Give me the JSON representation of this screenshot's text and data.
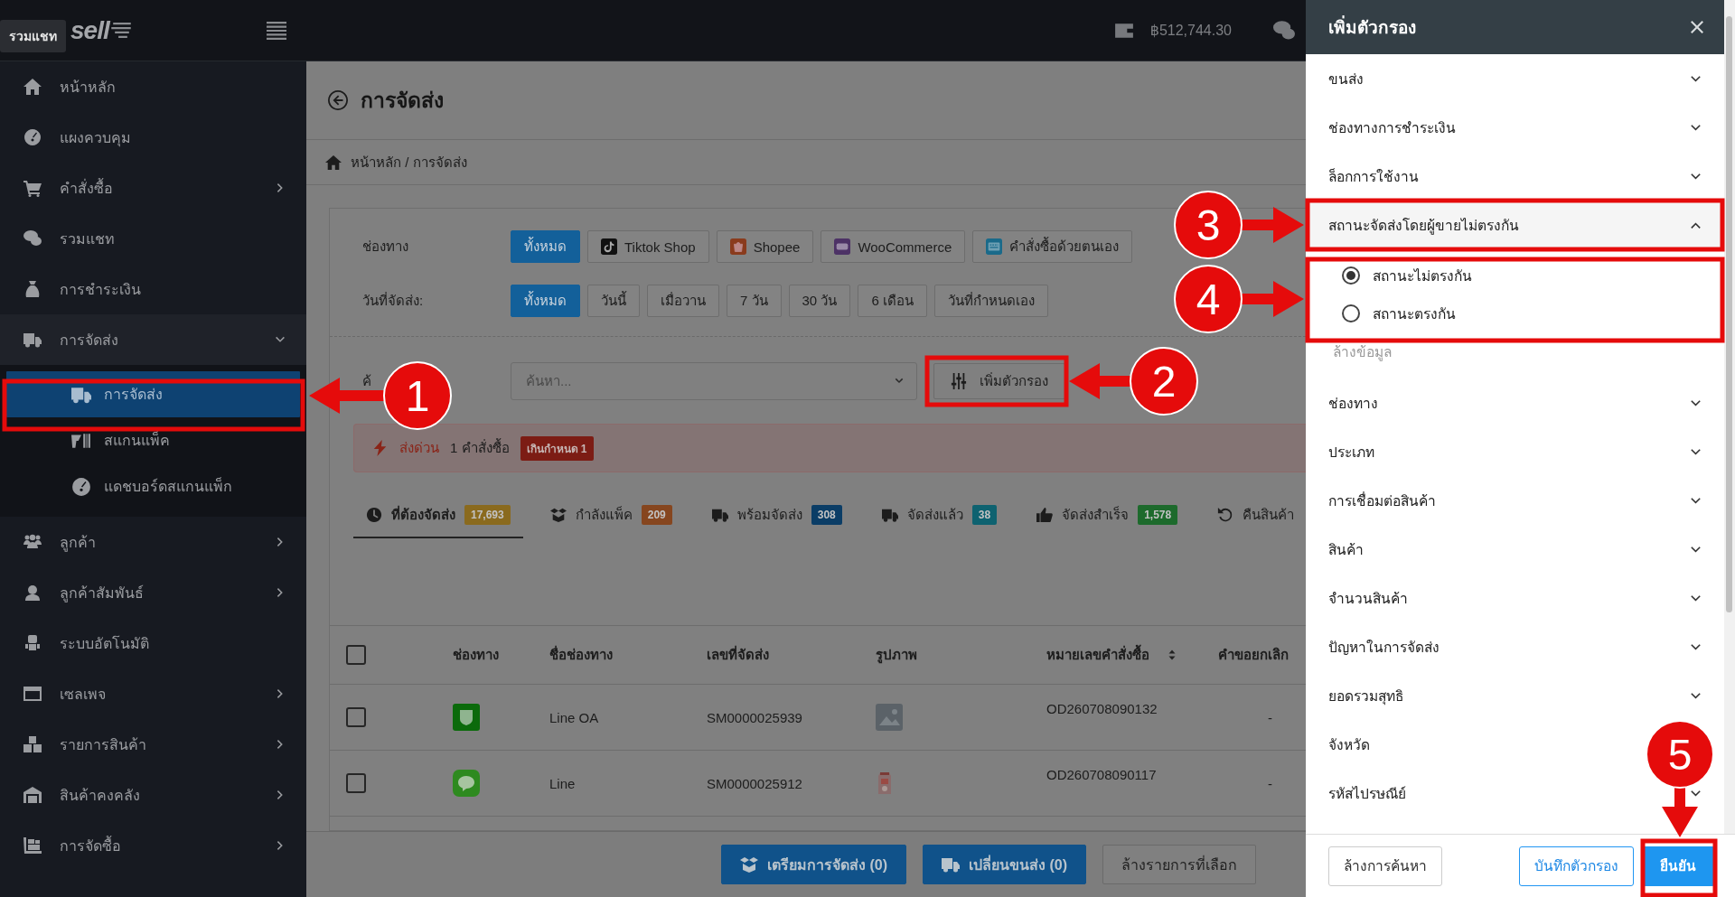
{
  "tooltip": {
    "text": "รวมแชท"
  },
  "logo": {
    "text": "sell"
  },
  "topbar": {
    "balance": "฿512,744.30"
  },
  "sidebar": {
    "items": [
      {
        "label": "หน้าหลัก",
        "has_submenu": false,
        "selected": false
      },
      {
        "label": "แผงควบคุม",
        "has_submenu": false,
        "selected": false
      },
      {
        "label": "คำสั่งซื้อ",
        "has_submenu": true,
        "expanded": false,
        "selected": false
      },
      {
        "label": "รวมแชท",
        "has_submenu": false,
        "selected": false
      },
      {
        "label": "การชำระเงิน",
        "has_submenu": false,
        "selected": false
      },
      {
        "label": "การจัดส่ง",
        "has_submenu": true,
        "expanded": true,
        "selected": false,
        "children": [
          {
            "label": "การจัดส่ง",
            "selected": true
          },
          {
            "label": "สแกนแพ็ค",
            "selected": false
          },
          {
            "label": "แดชบอร์ดสแกนแพ็ก",
            "selected": false
          }
        ]
      },
      {
        "label": "ลูกค้า",
        "has_submenu": true,
        "expanded": false,
        "selected": false
      },
      {
        "label": "ลูกค้าสัมพันธ์",
        "has_submenu": true,
        "expanded": false,
        "selected": false
      },
      {
        "label": "ระบบอัตโนมัติ",
        "has_submenu": false,
        "selected": false
      },
      {
        "label": "เซลเพจ",
        "has_submenu": true,
        "expanded": false,
        "selected": false
      },
      {
        "label": "รายการสินค้า",
        "has_submenu": true,
        "expanded": false,
        "selected": false
      },
      {
        "label": "สินค้าคงคลัง",
        "has_submenu": true,
        "expanded": false,
        "selected": false
      },
      {
        "label": "การจัดซื้อ",
        "has_submenu": true,
        "expanded": false,
        "selected": false
      }
    ]
  },
  "page": {
    "title": "การจัดส่ง",
    "breadcrumb": "หน้าหลัก / การจัดส่ง"
  },
  "filters": {
    "channel": {
      "label": "ช่องทาง",
      "options": [
        {
          "label": "ทั้งหมด",
          "selected": true
        },
        {
          "label": "Tiktok Shop",
          "selected": false
        },
        {
          "label": "Shopee",
          "selected": false
        },
        {
          "label": "WooCommerce",
          "selected": false
        },
        {
          "label": "คำสั่งซื้อด้วยตนเอง",
          "selected": false
        }
      ]
    },
    "date": {
      "label": "วันที่จัดส่ง:",
      "options": [
        {
          "label": "ทั้งหมด",
          "selected": true
        },
        {
          "label": "วันนี้",
          "selected": false
        },
        {
          "label": "เมื่อวาน",
          "selected": false
        },
        {
          "label": "7 วัน",
          "selected": false
        },
        {
          "label": "30 วัน",
          "selected": false
        },
        {
          "label": "6 เดือน",
          "selected": false
        },
        {
          "label": "วันที่กำหนดเอง",
          "selected": false
        }
      ]
    },
    "search": {
      "label": "ค้",
      "placeholder": "ค้นหา..."
    },
    "add_filter_button": "เพิ่มตัวกรอง"
  },
  "alert": {
    "title": "ส่งด่วน",
    "text": "1 คำสั่งซื้อ",
    "badge": "เกินกำหนด 1"
  },
  "status_tabs": [
    {
      "label": "ที่ต้องจัดส่ง",
      "count": "17,693",
      "color": "#8a6a1e",
      "selected": true
    },
    {
      "label": "กำลังแพ็ค",
      "count": "209",
      "color": "#86461f",
      "selected": false
    },
    {
      "label": "พร้อมจัดส่ง",
      "count": "308",
      "color": "#0b3d66",
      "selected": false
    },
    {
      "label": "จัดส่งแล้ว",
      "count": "38",
      "color": "#0e6270",
      "selected": false
    },
    {
      "label": "จัดส่งสำเร็จ",
      "count": "1,578",
      "color": "#1d6a2c",
      "selected": false
    },
    {
      "label": "คืนสินค้า",
      "selected": false
    }
  ],
  "table": {
    "select_all_checked": false,
    "columns": [
      {
        "label": "ช่องทาง",
        "sortable": false
      },
      {
        "label": "ชื่อช่องทาง",
        "sortable": false
      },
      {
        "label": "เลขที่จัดส่ง",
        "sortable": false
      },
      {
        "label": "รูปภาพ",
        "sortable": false
      },
      {
        "label": "หมายเลขคำสั่งซื้อ",
        "sortable": true
      },
      {
        "label": "คำขอยกเลิก",
        "sortable": false
      }
    ],
    "rows": [
      {
        "checked": false,
        "channel_name": "Line OA",
        "shipment_no": "SM0000025939",
        "order_no": "OD260708090132",
        "cancel_request": "-"
      },
      {
        "checked": false,
        "channel_name": "Line",
        "shipment_no": "SM0000025912",
        "order_no": "OD260708090117",
        "cancel_request": "-"
      }
    ]
  },
  "bulk_actions": [
    {
      "label": "เตรียมการจัดส่ง (0)",
      "kind": "primary"
    },
    {
      "label": "เปลี่ยนขนส่ง (0)",
      "kind": "primary"
    },
    {
      "label": "ล้างรายการที่เลือก",
      "kind": "outline"
    }
  ],
  "drawer": {
    "title": "เพิ่มตัวกรอง",
    "sections": [
      {
        "label": "ขนส่ง",
        "expanded": false
      },
      {
        "label": "ช่องทางการชำระเงิน",
        "expanded": false
      },
      {
        "label": "ล็อกการใช้งาน",
        "expanded": false
      },
      {
        "label": "สถานะจัดส่งโดยผู้ขายไม่ตรงกัน",
        "expanded": true,
        "options": [
          {
            "label": "สถานะไม่ตรงกัน",
            "selected": true
          },
          {
            "label": "สถานะตรงกัน",
            "selected": false
          }
        ],
        "clear_link": "ล้างข้อมูล"
      },
      {
        "label": "ช่องทาง",
        "expanded": false
      },
      {
        "label": "ประเภท",
        "expanded": false
      },
      {
        "label": "การเชื่อมต่อสินค้า",
        "expanded": false
      },
      {
        "label": "สินค้า",
        "expanded": false
      },
      {
        "label": "จำนวนสินค้า",
        "expanded": false
      },
      {
        "label": "ปัญหาในการจัดส่ง",
        "expanded": false
      },
      {
        "label": "ยอดรวมสุทธิ",
        "expanded": false
      },
      {
        "label": "จังหวัด"
      },
      {
        "label": "รหัสไปรษณีย์",
        "expanded": false
      }
    ],
    "footer_buttons": [
      {
        "label": "ล้างการค้นหา",
        "kind": "secondary"
      },
      {
        "label": "บันทึกตัวกรอง",
        "kind": "outline"
      },
      {
        "label": "ยืนยัน",
        "kind": "primary"
      }
    ]
  },
  "annotations": [
    {
      "number": "1"
    },
    {
      "number": "2"
    },
    {
      "number": "3"
    },
    {
      "number": "4"
    },
    {
      "number": "5"
    }
  ]
}
